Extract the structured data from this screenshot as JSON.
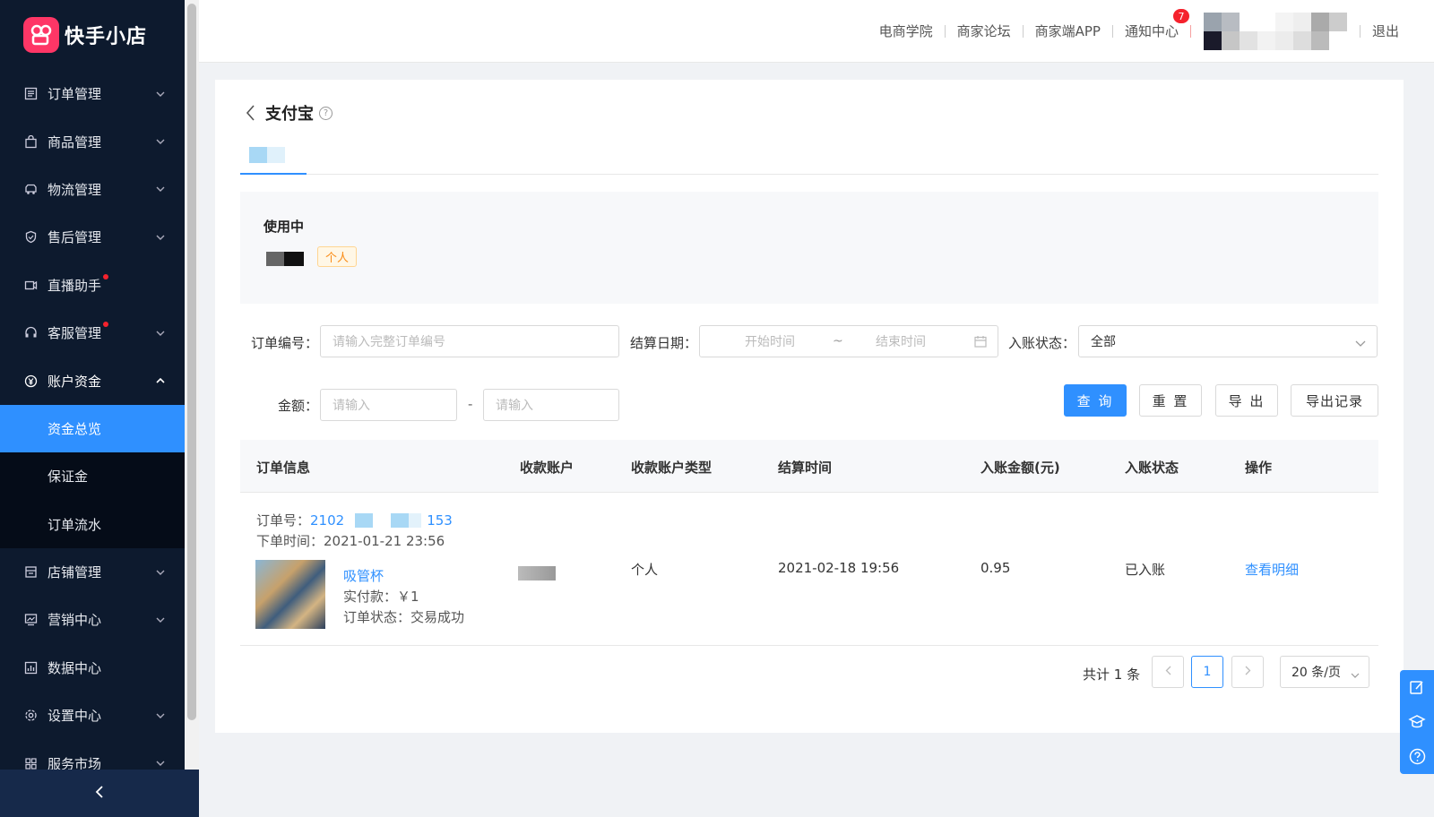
{
  "brand": {
    "name": "快手小店"
  },
  "sidebar": {
    "items": [
      {
        "label": "订单管理",
        "icon": "order-icon"
      },
      {
        "label": "商品管理",
        "icon": "bag-icon"
      },
      {
        "label": "物流管理",
        "icon": "truck-icon"
      },
      {
        "label": "售后管理",
        "icon": "shield-icon"
      },
      {
        "label": "直播助手",
        "icon": "video-icon"
      },
      {
        "label": "客服管理",
        "icon": "headset-icon"
      },
      {
        "label": "账户资金",
        "icon": "yen-icon"
      },
      {
        "label": "店铺管理",
        "icon": "store-icon"
      },
      {
        "label": "营销中心",
        "icon": "chart-icon"
      },
      {
        "label": "数据中心",
        "icon": "bar-chart-icon"
      },
      {
        "label": "设置中心",
        "icon": "gear-icon"
      },
      {
        "label": "服务市场",
        "icon": "grid-icon"
      }
    ],
    "sub_items": [
      {
        "label": "资金总览"
      },
      {
        "label": "保证金"
      },
      {
        "label": "订单流水"
      }
    ]
  },
  "header": {
    "links": [
      "电商学院",
      "商家论坛",
      "商家端APP",
      "通知中心"
    ],
    "notification_count": "7",
    "logout": "退出"
  },
  "page": {
    "title": "支付宝",
    "status_label": "使用中",
    "account_type_tag": "个人"
  },
  "filters": {
    "order_no_label": "订单编号：",
    "order_no_placeholder": "请输入完整订单编号",
    "settle_date_label": "结算日期：",
    "start_placeholder": "开始时间",
    "range_sep": "~",
    "end_placeholder": "结束时间",
    "status_label": "入账状态：",
    "status_value": "全部",
    "amount_label": "金额：",
    "amount_min_placeholder": "请输入",
    "amount_sep": "-",
    "amount_max_placeholder": "请输入"
  },
  "buttons": {
    "query": "查 询",
    "reset": "重 置",
    "export": "导 出",
    "export_records": "导出记录"
  },
  "table": {
    "headers": [
      "订单信息",
      "收款账户",
      "收款账户类型",
      "结算时间",
      "入账金额(元)",
      "入账状态",
      "操作"
    ],
    "rows": [
      {
        "order_no_label": "订单号：",
        "order_no_prefix": "2102",
        "order_no_suffix": "153",
        "order_time": "下单时间：2021-01-21 23:56",
        "product_name": "吸管杯",
        "paid": "实付款：￥1",
        "order_status": "订单状态：交易成功",
        "account_type": "个人",
        "settle_time": "2021-02-18 19:56",
        "amount": "0.95",
        "status": "已入账",
        "action": "查看明细"
      }
    ]
  },
  "pagination": {
    "total": "共计 1 条",
    "current": "1",
    "page_size": "20 条/页"
  }
}
